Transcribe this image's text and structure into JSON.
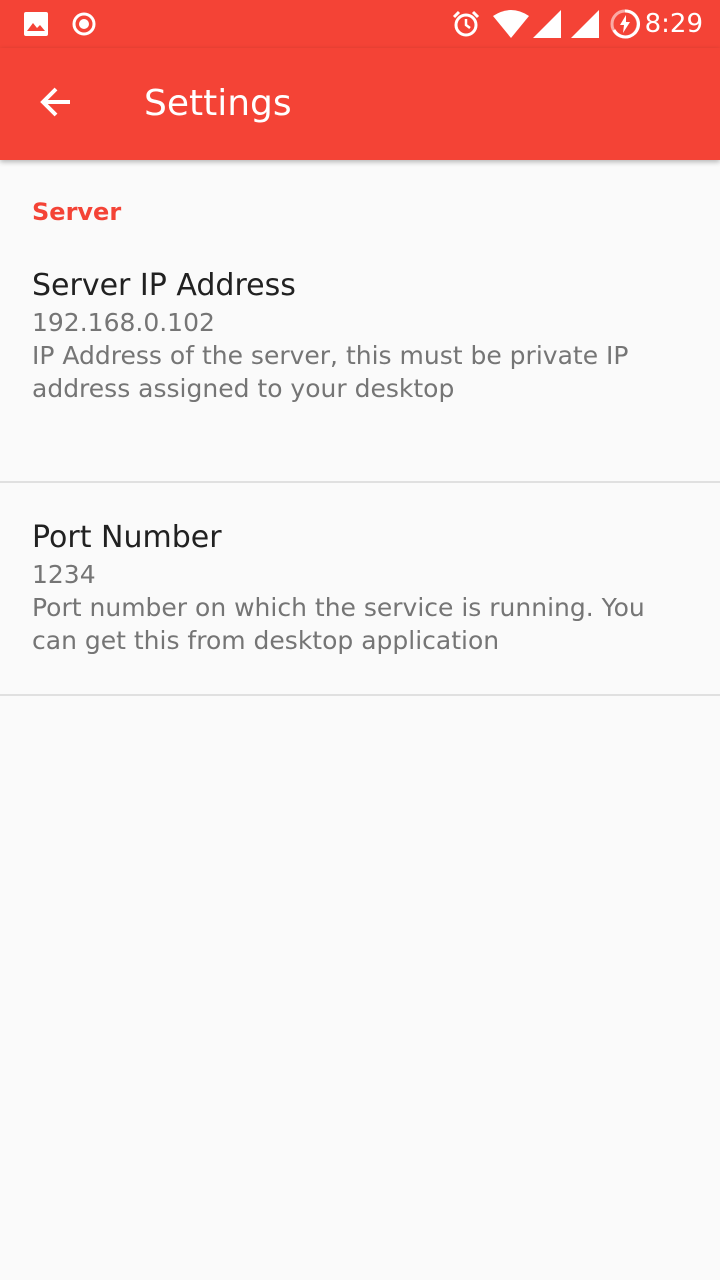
{
  "status_bar": {
    "time": "8:29",
    "icons": [
      "image-icon",
      "record-icon",
      "alarm-icon",
      "wifi-icon",
      "signal-icon",
      "signal-icon",
      "battery-charging-icon"
    ]
  },
  "app_bar": {
    "title": "Settings",
    "back_icon": "arrow-back-icon"
  },
  "category": {
    "label": "Server"
  },
  "preferences": [
    {
      "title": "Server IP Address",
      "value": "192.168.0.102",
      "summary": "IP Address of the server, this must be private IP address assigned to your desktop"
    },
    {
      "title": "Port Number",
      "value": "1234",
      "summary": "Port number on which the service is running. You can get this from desktop application"
    }
  ],
  "colors": {
    "primary": "#f44336",
    "background": "#fafafa",
    "divider": "#e0e0e0"
  }
}
